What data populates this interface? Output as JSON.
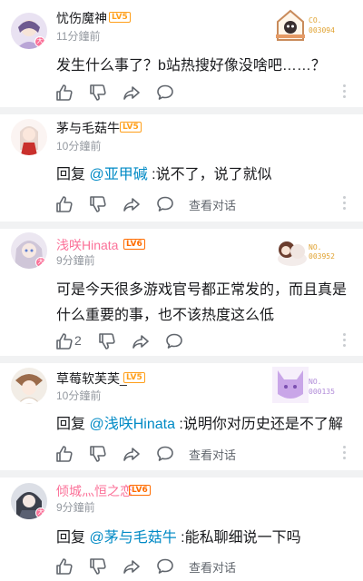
{
  "comments": [
    {
      "username": "忧伤魔神",
      "level": "LV5",
      "time": "11分鐘前",
      "text": "发生什么事了？b站热搜好像没啥吧……？",
      "fan_label": "CO.",
      "fan_number": "003094",
      "show_replies": ""
    },
    {
      "username": "茅与毛菇牛",
      "level": "LV5",
      "time": "10分鐘前",
      "reply_prefix": "回复",
      "mention": "@亚甲碱",
      "text": ":说不了，说了就似",
      "show_replies": "查看对话"
    },
    {
      "username": "浅咲Hinata",
      "level": "LV6",
      "time": "9分鐘前",
      "text": "可是今天很多游戏官号都正常发的，而且真是什么重要的事，也不该热度这么低",
      "like_count": "2",
      "fan_label": "NO.",
      "fan_number": "003952"
    },
    {
      "username": "草莓软芙芙_",
      "level": "LV5",
      "time": "10分鐘前",
      "reply_prefix": "回复",
      "mention": "@浅咲Hinata",
      "text": ":说明你对历史还是不了解",
      "show_replies": "查看对话",
      "fan_label": "NO.",
      "fan_number": "000135"
    },
    {
      "username": "倾城灬恒之恋",
      "level": "LV6",
      "time": "9分鐘前",
      "reply_prefix": "回复",
      "mention": "@茅与毛菇牛",
      "text": ":能私聊细说一下吗",
      "show_replies": "查看对话"
    }
  ],
  "colors": {
    "level5": "#ff9f1a",
    "level6": "#ff6c00",
    "vip_name": "#fb7299",
    "mention": "#008ac5",
    "fan_number": "#e0a230"
  },
  "icons": [
    "like-icon",
    "dislike-icon",
    "share-icon",
    "comment-icon",
    "more-icon"
  ]
}
